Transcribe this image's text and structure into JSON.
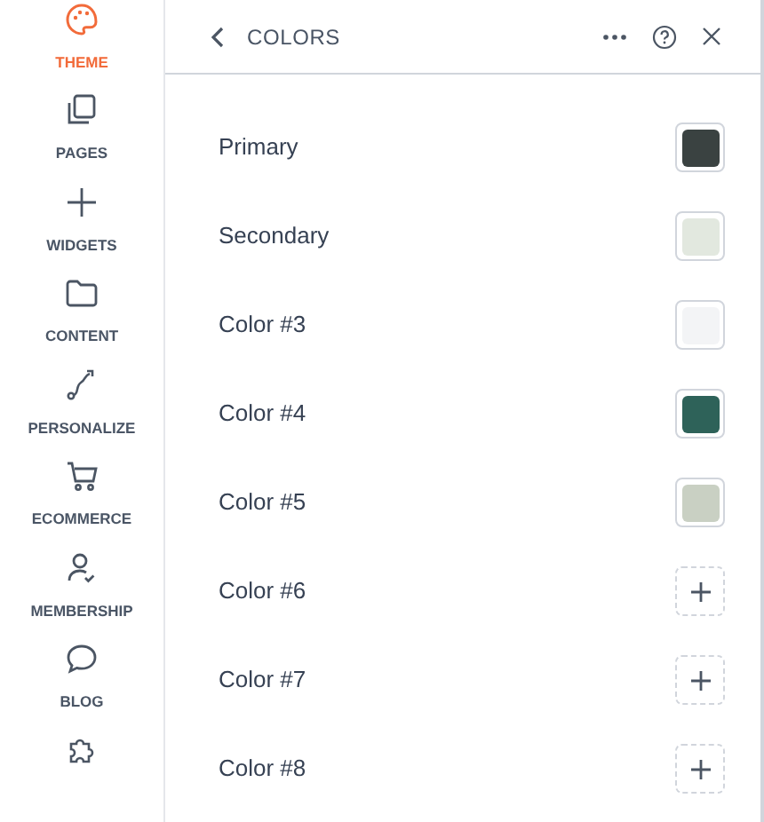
{
  "sidebar": {
    "items": [
      {
        "label": "THEME",
        "selected": true
      },
      {
        "label": "PAGES",
        "selected": false
      },
      {
        "label": "WIDGETS",
        "selected": false
      },
      {
        "label": "CONTENT",
        "selected": false
      },
      {
        "label": "PERSONALIZE",
        "selected": false
      },
      {
        "label": "ECOMMERCE",
        "selected": false
      },
      {
        "label": "MEMBERSHIP",
        "selected": false
      },
      {
        "label": "BLOG",
        "selected": false
      },
      {
        "selected": false
      }
    ]
  },
  "panel": {
    "title": "COLORS",
    "colors": [
      {
        "label": "Primary",
        "kind": "swatch",
        "color": "#3a4241"
      },
      {
        "label": "Secondary",
        "kind": "swatch",
        "color": "#e2e8df"
      },
      {
        "label": "Color #3",
        "kind": "swatch",
        "color": "#f3f4f6"
      },
      {
        "label": "Color #4",
        "kind": "swatch",
        "color": "#2e6259"
      },
      {
        "label": "Color #5",
        "kind": "swatch",
        "color": "#c9d0c3"
      },
      {
        "label": "Color #6",
        "kind": "empty"
      },
      {
        "label": "Color #7",
        "kind": "empty"
      },
      {
        "label": "Color #8",
        "kind": "empty"
      }
    ]
  }
}
